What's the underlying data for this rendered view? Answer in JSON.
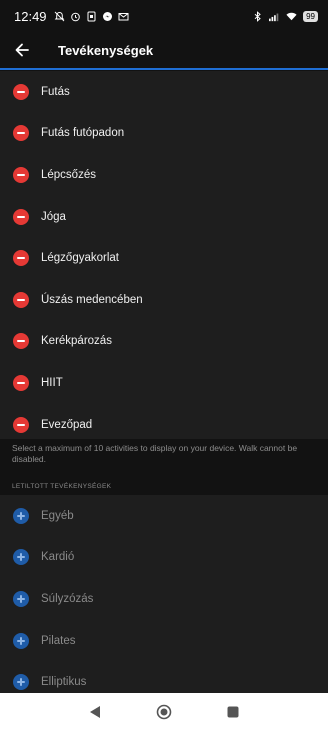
{
  "status_bar": {
    "time": "12:49",
    "battery": "99"
  },
  "header": {
    "title": "Tevékenységek"
  },
  "enabled_activities": [
    {
      "label": "Futás"
    },
    {
      "label": "Futás futópadon"
    },
    {
      "label": "Lépcsőzés"
    },
    {
      "label": "Jóga"
    },
    {
      "label": "Légzőgyakorlat"
    },
    {
      "label": "Úszás medencében"
    },
    {
      "label": "Kerékpározás"
    },
    {
      "label": "HIIT"
    },
    {
      "label": "Evezőpad"
    }
  ],
  "hint_text": "Select a maximum of 10 activities to display on your device. Walk cannot be disabled.",
  "disabled_section_label": "LETILTOTT TEVÉKENYSÉGEK",
  "disabled_activities": [
    {
      "label": "Egyéb"
    },
    {
      "label": "Kardió"
    },
    {
      "label": "Súlyzózás"
    },
    {
      "label": "Pilates"
    },
    {
      "label": "Elliptikus"
    }
  ],
  "colors": {
    "remove": "#e53935",
    "add": "#1f5ca8",
    "accent": "#1f6ed4"
  }
}
